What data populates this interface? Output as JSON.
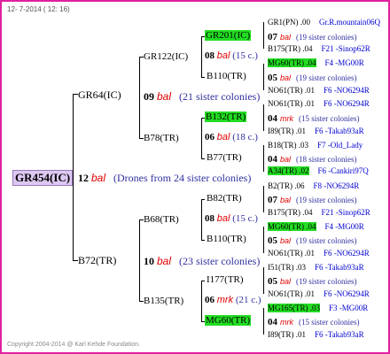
{
  "header": "12-  7-2014 ( 12: 16)",
  "footer": "Copyright 2004-2014 @ Karl Kehde Foundation.",
  "root": {
    "label": "GR454(IC)",
    "count": "12",
    "mark": "bal",
    "note": "(Drones from 24 sister colonies)"
  },
  "top": {
    "label": "GR64(IC)",
    "count": "09",
    "mark": "bal",
    "note": "(21 sister colonies)"
  },
  "bottom": {
    "label": "B72(TR)",
    "count": "10",
    "mark": "bal",
    "note": "(23 sister colonies)"
  },
  "level2": [
    {
      "label": "GR122(IC)"
    },
    {
      "label": "B78(TR)"
    },
    {
      "label": "B68(TR)"
    },
    {
      "label": "B135(TR)"
    }
  ],
  "level3": [
    {
      "label": "GR201(IC)",
      "count": "08",
      "mark": "bal",
      "note": "(15 c.)"
    },
    {
      "label": "B110(TR)"
    },
    {
      "label": "B132(TR)",
      "count": "06",
      "mark": "bal",
      "note": "(18 c.)"
    },
    {
      "label": "B77(TR)"
    },
    {
      "label": "B82(TR)",
      "count": "08",
      "mark": "bal",
      "note": "(15 c.)"
    },
    {
      "label": "B110(TR)"
    },
    {
      "label": "I177(TR)",
      "count": "06",
      "mark": "mrk",
      "note": "(21 c.)"
    },
    {
      "label": "MG60(TR)"
    }
  ],
  "level4": [
    {
      "a": "GR1(PN) .00",
      "b": "Gr.R.mountain06Q"
    },
    {
      "a": "07",
      "m": "bal",
      "b": "(19 sister colonies)"
    },
    {
      "a": "B175(TR) .04",
      "b": "F21 -Sinop62R"
    },
    {
      "a": "MG60(TR) .04",
      "b": "F4 -MG00R"
    },
    {
      "a": "05",
      "m": "bal",
      "b": "(19 sister colonies)"
    },
    {
      "a": "NO61(TR) .01",
      "b": "F6 -NO6294R"
    },
    {
      "a": "NO61(TR) .01",
      "b": "F6 -NO6294R"
    },
    {
      "a": "04",
      "m": "mrk",
      "b": "(15 sister colonies)"
    },
    {
      "a": "I89(TR) .01",
      "b": "F6 -Takab93aR"
    },
    {
      "a": "B18(TR) .03",
      "b": "F7 -Old_Lady"
    },
    {
      "a": "04",
      "m": "bal",
      "b": "(18 sister colonies)"
    },
    {
      "a": "A34(TR) .02",
      "b": "F6 -Cankiri97Q"
    },
    {
      "a": "B2(TR) .06",
      "b": "F8 -NO6294R"
    },
    {
      "a": "07",
      "m": "bal",
      "b": "(19 sister colonies)"
    },
    {
      "a": "B175(TR) .04",
      "b": "F21 -Sinop62R"
    },
    {
      "a": "MG60(TR) .04",
      "b": "F4 -MG00R"
    },
    {
      "a": "05",
      "m": "bal",
      "b": "(19 sister colonies)"
    },
    {
      "a": "NO61(TR) .01",
      "b": "F6 -NO6294R"
    },
    {
      "a": "I51(TR) .03",
      "b": "F6 -Takab93aR"
    },
    {
      "a": "05",
      "m": "bal",
      "b": "(19 sister colonies)"
    },
    {
      "a": "NO61(TR) .01",
      "b": "F6 -NO6294R"
    },
    {
      "a": "MG165(TR) .03",
      "b": "F3 -MG00R"
    },
    {
      "a": "04",
      "m": "mrk",
      "b": "(15 sister colonies)"
    },
    {
      "a": "I89(TR) .01",
      "b": "F6 -Takab93aR"
    }
  ],
  "colors": {
    "highlight": "#22dd22",
    "border": "#e020a0",
    "rootbg": "#dcc8f2",
    "red": "#e00000",
    "blue": "#0000d0"
  }
}
